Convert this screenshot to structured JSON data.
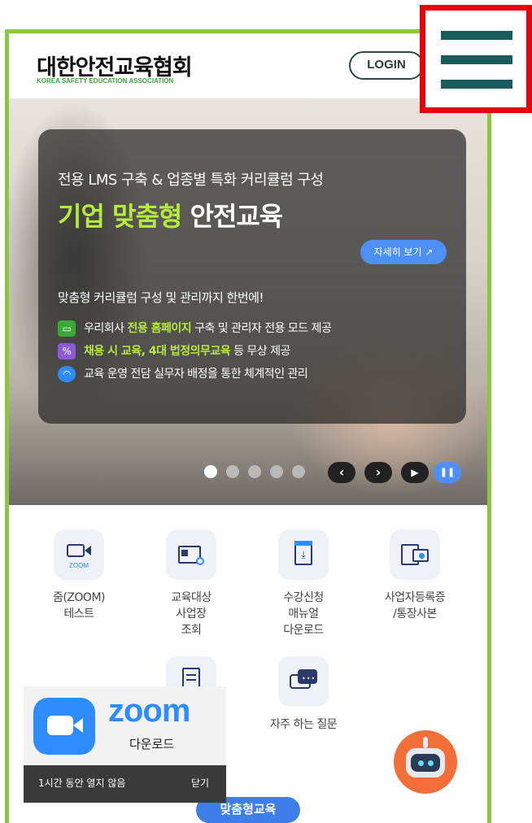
{
  "header": {
    "logo_ko": "대한안전교육협회",
    "logo_en": "KOREA SAFETY EDUCATION ASSOCIATION",
    "login_label": "LOGIN",
    "menu_icon": "hamburger-menu-icon"
  },
  "hero": {
    "sub_title": "전용 LMS 구축 & 업종별 특화 커리큘럼 구성",
    "main_title_highlight": "기업 맞춤형",
    "main_title_rest": " 안전교육",
    "detail_button": "자세히 보기 ↗",
    "description": "맞춤형 커리큘럼 구성 및 관리까지 한번에!",
    "features": [
      {
        "icon": "monitor-icon",
        "pre": "우리회사 ",
        "bold": "전용 홈페이지",
        "post": " 구축 및 관리자 전용 모드 제공"
      },
      {
        "icon": "percent-icon",
        "pre": "",
        "bold": "채용 시 교육, 4대 법정의무교육",
        "post": " 등 무상 제공"
      },
      {
        "icon": "headset-icon",
        "pre": "교육 운영 전담 실무자 배정을 통한 체계적인 관리",
        "bold": "",
        "post": ""
      }
    ],
    "slide_count": 5,
    "active_slide": 1,
    "controls": {
      "prev": "‹",
      "next": "›",
      "play": "▶",
      "pause": "❚❚"
    }
  },
  "quick_menu": {
    "items": [
      {
        "icon": "zoom-icon",
        "label": "줌(ZOOM)\n테스트"
      },
      {
        "icon": "business-search-icon",
        "label": "교육대상\n사업장\n조회"
      },
      {
        "icon": "download-manual-icon",
        "label": "수강신청\n매뉴얼\n다운로드"
      },
      {
        "icon": "id-card-icon",
        "label": "사업자등록증\n/통장사본"
      },
      {
        "icon": "document-icon",
        "label": ""
      },
      {
        "icon": "chat-icon",
        "label": "자주 하는 질문"
      }
    ]
  },
  "zoom_popup": {
    "brand": "zoom",
    "download_label": "다운로드",
    "hide_label": "1시간 동안 열지 않음",
    "close_label": "닫기"
  },
  "chatbot": {
    "icon": "robot-chatbot-icon"
  },
  "bottom_pill": {
    "label": "맞춤형교육"
  },
  "colors": {
    "accent_green": "#8cc63f",
    "highlight_green": "#b6ea3c",
    "primary_blue": "#4d8ff2",
    "alert_red": "#e8000b",
    "menu_teal": "#1a5c5c"
  }
}
